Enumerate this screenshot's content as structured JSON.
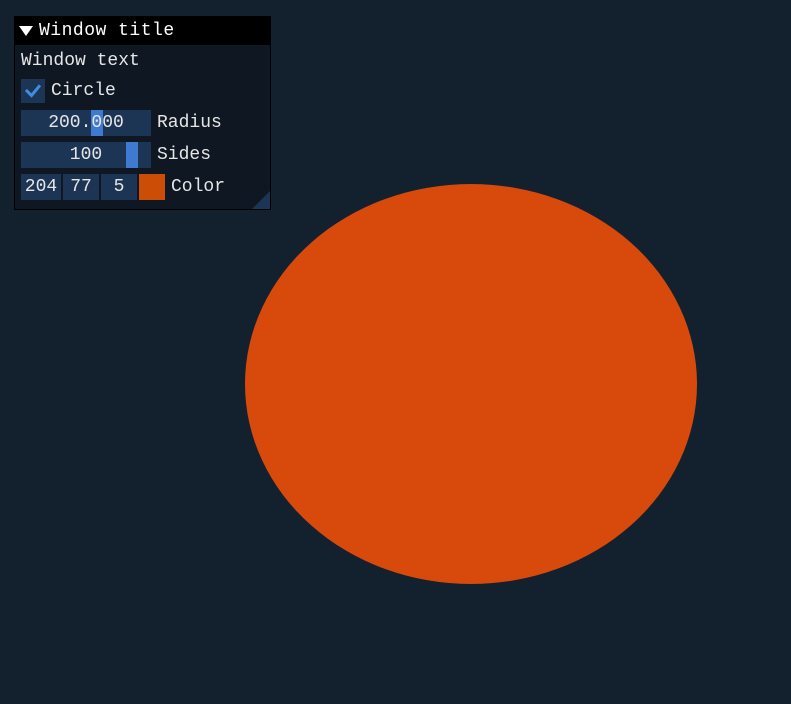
{
  "window": {
    "title": "Window title",
    "text": "Window text"
  },
  "circle_checkbox": {
    "label": "Circle",
    "checked": true
  },
  "radius": {
    "label": "Radius",
    "value_display": "200.000",
    "value": 200.0
  },
  "sides": {
    "label": "Sides",
    "value_display": "100",
    "value": 100
  },
  "color": {
    "label": "Color",
    "r": 204,
    "g": 77,
    "b": 5,
    "hex": "#cc4d05"
  },
  "canvas": {
    "shape_fill": "#d8490c"
  }
}
